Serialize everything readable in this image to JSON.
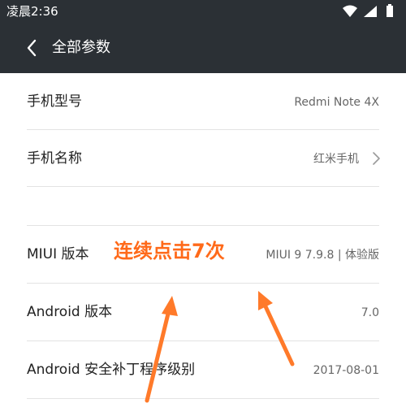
{
  "status_bar": {
    "time": "凌晨2:36",
    "icons": [
      "wifi-icon",
      "signal-icon",
      "battery-icon"
    ]
  },
  "header": {
    "title": "全部参数",
    "back_icon": "back-arrow-icon"
  },
  "rows": [
    {
      "label": "手机型号",
      "value": "Redmi Note 4X"
    },
    {
      "label": "手机名称",
      "value": "红米手机",
      "icon": "chevron-right-icon"
    },
    {
      "label": "",
      "value": ""
    },
    {
      "label": "MIUI 版本",
      "value": "MIUI 9 7.9.8 | 体验版"
    },
    {
      "label": "Android 版本",
      "value": "7.0"
    },
    {
      "label": "Android 安全补丁程序级别",
      "value": "2017-08-01"
    }
  ],
  "annotation": {
    "text": "连续点击7次",
    "color": "#ff6a1a"
  },
  "colors": {
    "header_bg": "#2b3035",
    "background": "#ffffff",
    "divider": "#e3e3e3",
    "accent": "#ff6a1a"
  }
}
